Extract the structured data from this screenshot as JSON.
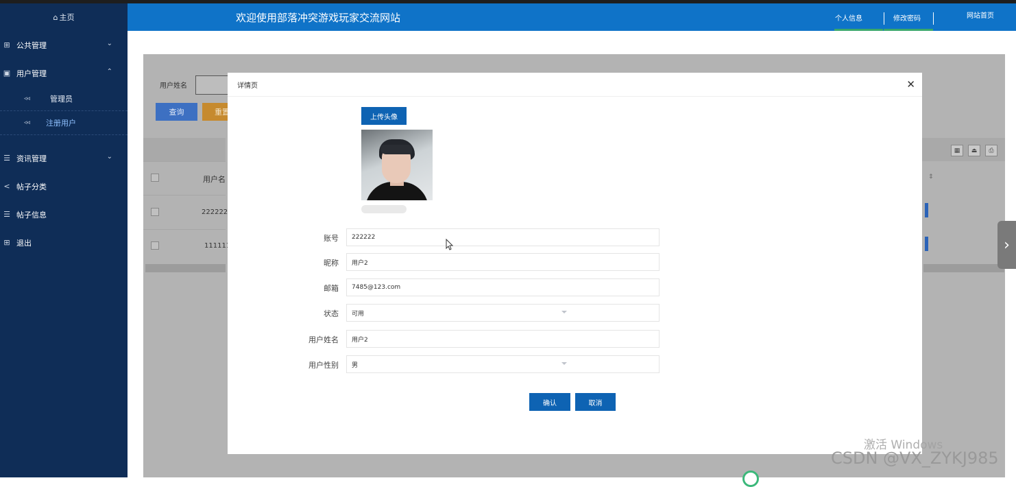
{
  "sidebar": {
    "home": "主页",
    "items": [
      {
        "label": "公共管理",
        "icon": "grid-icon",
        "chevron": "down"
      },
      {
        "label": "用户管理",
        "icon": "book-icon",
        "chevron": "up"
      },
      {
        "label": "资讯管理",
        "icon": "list-icon",
        "chevron": "down"
      },
      {
        "label": "帖子分类",
        "icon": "share-icon"
      },
      {
        "label": "帖子信息",
        "icon": "list-icon"
      },
      {
        "label": "退出",
        "icon": "grid-icon"
      }
    ],
    "subitems": [
      {
        "label": "管理员"
      },
      {
        "label": "注册用户",
        "active": true
      }
    ]
  },
  "header": {
    "title": "欢迎使用部落冲突游戏玩家交流网站",
    "nav_profile": "个人信息",
    "nav_password": "修改密码",
    "nav_home": "网站首页"
  },
  "background": {
    "search_label": "用户姓名",
    "query_button": "查询",
    "reset_button": "重置",
    "column_username": "用户名",
    "rows": [
      "222222",
      "111111"
    ]
  },
  "modal": {
    "title": "详情页",
    "upload_button": "上传头像",
    "fields": [
      {
        "label": "账号",
        "value": "222222"
      },
      {
        "label": "昵称",
        "value": "用户2"
      },
      {
        "label": "邮箱",
        "value": "7485@123.com"
      },
      {
        "label": "状态",
        "value": "可用",
        "select": true
      },
      {
        "label": "用户姓名",
        "value": "用户2"
      },
      {
        "label": "用户性别",
        "value": "男",
        "select": true
      }
    ],
    "ok_button": "确认",
    "cancel_button": "取消"
  },
  "watermarks": {
    "windows": "激活 Windows",
    "csdn": "CSDN @VX_ZYKJ985"
  },
  "colors": {
    "sidebar_bg": "#0f2d57",
    "header_bg": "#0f73c8",
    "primary_button": "#0e63b3",
    "nav_underline": "#3aa86b"
  }
}
